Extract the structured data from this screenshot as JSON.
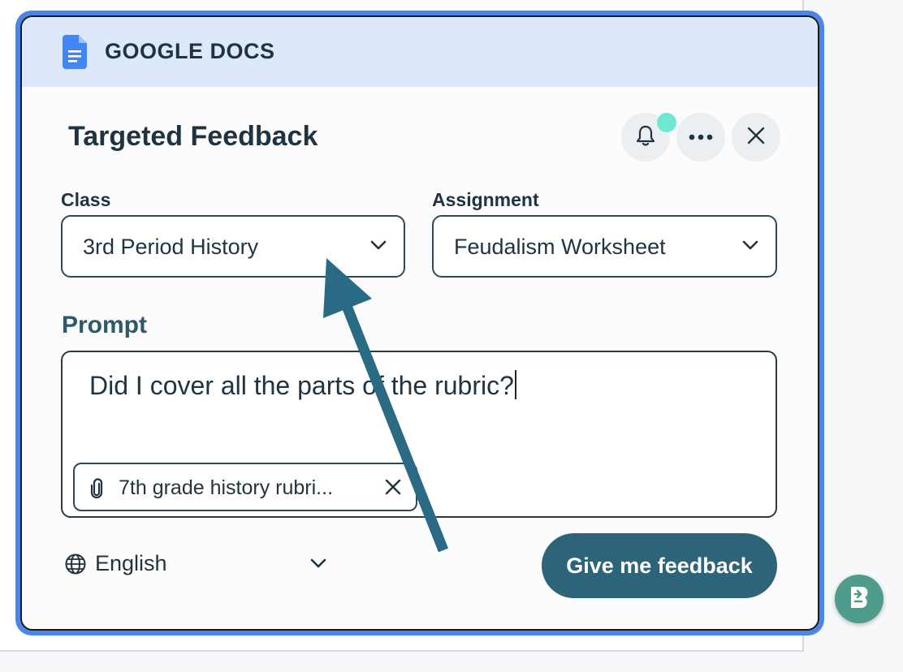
{
  "header": {
    "app_name": "GOOGLE DOCS",
    "icon": "google-docs-icon"
  },
  "panel": {
    "title": "Targeted Feedback",
    "actions": [
      {
        "icon": "bell-icon",
        "has_notification": true,
        "notification_color": "#6ee8d2"
      },
      {
        "icon": "more-icon"
      },
      {
        "icon": "close-icon"
      }
    ]
  },
  "class_field": {
    "label": "Class",
    "value": "3rd Period History"
  },
  "assignment_field": {
    "label": "Assignment",
    "value": "Feudalism Worksheet"
  },
  "prompt": {
    "label": "Prompt",
    "value": "Did I cover all the parts of the rubric?",
    "attachment": {
      "icon": "paperclip-icon",
      "label": "7th grade history rubri..."
    }
  },
  "language": {
    "icon": "globe-icon",
    "value": "English"
  },
  "submit_label": "Give me feedback",
  "annotation": {
    "type": "arrow",
    "color": "#2b6a85",
    "points_to": "class-select"
  },
  "colors": {
    "accent": "#4a86e8",
    "header_bg": "#dde9fb",
    "button": "#2e6479",
    "text": "#1f3340",
    "fab": "#4e9d8c"
  },
  "extension_fab": {
    "icon": "extension-logo-icon"
  }
}
